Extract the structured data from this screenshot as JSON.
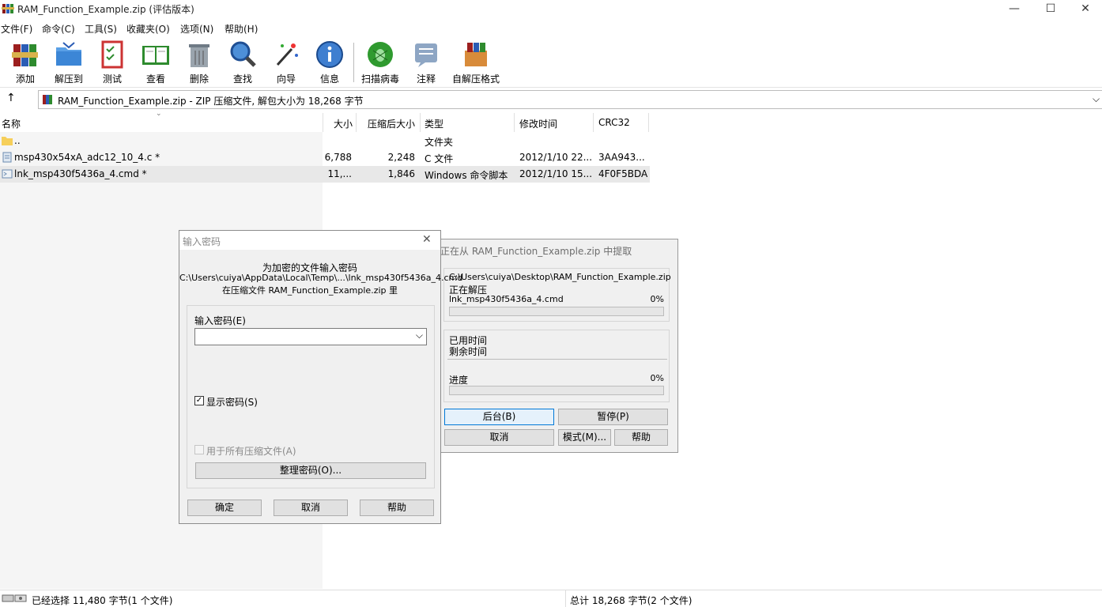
{
  "window": {
    "title": "RAM_Function_Example.zip (评估版本)",
    "minimize_glyph": "—",
    "maximize_glyph": "☐",
    "close_glyph": "✕"
  },
  "menu": [
    "文件(F)",
    "命令(C)",
    "工具(S)",
    "收藏夹(O)",
    "选项(N)",
    "帮助(H)"
  ],
  "toolbar": [
    "添加",
    "解压到",
    "测试",
    "查看",
    "删除",
    "查找",
    "向导",
    "信息",
    "扫描病毒",
    "注释",
    "自解压格式"
  ],
  "address": {
    "up_glyph": "↑",
    "text": "RAM_Function_Example.zip - ZIP 压缩文件, 解包大小为 18,268 字节",
    "dropdown_glyph": "⌵"
  },
  "columns": [
    "名称",
    "大小",
    "压缩后大小",
    "类型",
    "修改时间",
    "CRC32"
  ],
  "files": [
    {
      "name": "..",
      "size": "",
      "packed": "",
      "type": "文件夹",
      "modified": "",
      "crc": ""
    },
    {
      "name": "msp430x54xA_adc12_10_4.c *",
      "size": "6,788",
      "packed": "2,248",
      "type": "C 文件",
      "modified": "2012/1/10 22...",
      "crc": "3AA943..."
    },
    {
      "name": "lnk_msp430f5436a_4.cmd *",
      "size": "11,...",
      "packed": "1,846",
      "type": "Windows 命令脚本",
      "modified": "2012/1/10 15...",
      "crc": "4F0F5BDA"
    }
  ],
  "status": {
    "left": "已经选择 11,480 字节(1 个文件)",
    "right": "总计 18,268 字节(2 个文件)"
  },
  "extract_dialog": {
    "title": "正在从 RAM_Function_Example.zip 中提取",
    "path": "C:\\Users\\cuiya\\Desktop\\RAM_Function_Example.zip",
    "status": "正在解压",
    "file": "lnk_msp430f5436a_4.cmd",
    "file_percent": "0%",
    "file_progress": 0,
    "elapsed_label": "已用时间",
    "remaining_label": "剩余时间",
    "progress_label": "进度",
    "progress_percent": "0%",
    "total_progress": 0,
    "buttons": {
      "background": "后台(B)",
      "pause": "暂停(P)",
      "cancel": "取消",
      "mode": "模式(M)...",
      "help": "帮助"
    }
  },
  "password_dialog": {
    "title": "输入密码",
    "close_glyph": "✕",
    "heading": "为加密的文件输入密码",
    "path": "C:\\Users\\cuiya\\AppData\\Local\\Temp\\...\\lnk_msp430f5436a_4.cmd",
    "archive_line": "在压缩文件 RAM_Function_Example.zip 里",
    "field_label": "输入密码(E)",
    "field_value": "",
    "dropdown_glyph": "⌵",
    "show_password": "显示密码(S)",
    "show_password_checked": true,
    "use_for_all": "用于所有压缩文件(A)",
    "use_for_all_checked": false,
    "organize": "整理密码(O)...",
    "ok": "确定",
    "cancel": "取消",
    "help": "帮助"
  }
}
